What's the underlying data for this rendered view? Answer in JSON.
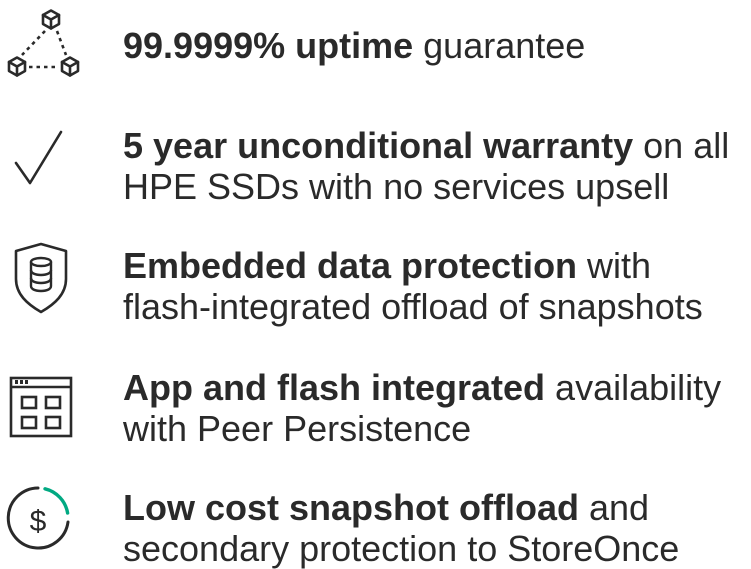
{
  "features": [
    {
      "icon": "network-cubes-icon",
      "bold": "99.9999% uptime",
      "rest": " guarantee",
      "line2": ""
    },
    {
      "icon": "checkmark-icon",
      "bold": "5 year unconditional warranty",
      "rest": " on all",
      "line2": "HPE SSDs with no services upsell"
    },
    {
      "icon": "shield-database-icon",
      "bold": "Embedded data protection",
      "rest": " with",
      "line2": "flash-integrated offload of snapshots"
    },
    {
      "icon": "app-window-grid-icon",
      "bold": "App and flash integrated",
      "rest": " availability",
      "line2": "with Peer Persistence"
    },
    {
      "icon": "dollar-circle-icon",
      "bold": "Low cost snapshot offload",
      "rest": " and",
      "line2": "secondary protection to StoreOnce"
    }
  ],
  "colors": {
    "text": "#2a2a2a",
    "icon": "#2a2a2a",
    "accent": "#01a982"
  }
}
